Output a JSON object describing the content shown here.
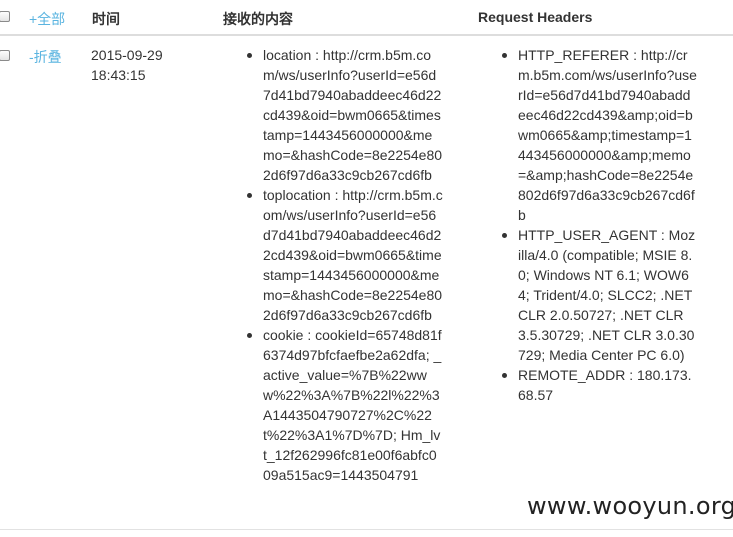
{
  "header": {
    "select_all_label": "+全部",
    "time_label": "时间",
    "content_label": "接收的内容",
    "headers_label": "Request Headers"
  },
  "row": {
    "fold_label": "-折叠",
    "time": "2015-09-29 18:43:15",
    "content_items": [
      "location : http://crm.b5m.com/ws/userInfo?userId=e56d7d41bd7940abaddeec46d22cd439&oid=bwm0665&timestamp=1443456000000&memo=&hashCode=8e2254e802d6f97d6a33c9cb267cd6fb",
      "toplocation : http://crm.b5m.com/ws/userInfo?userId=e56d7d41bd7940abaddeec46d22cd439&oid=bwm0665&timestamp=1443456000000&memo=&hashCode=8e2254e802d6f97d6a33c9cb267cd6fb",
      "cookie : cookieId=65748d81f6374d97bfcfaefbe2a62dfa; _active_value=%7B%22www%22%3A%7B%22l%22%3A1443504790727%2C%22t%22%3A1%7D%7D; Hm_lvt_12f262996fc81e00f6abfc009a515ac9=1443504791"
    ],
    "header_items": [
      "HTTP_REFERER : http://crm.b5m.com/ws/userInfo?userId=e56d7d41bd7940abaddeec46d22cd439&amp;oid=bwm0665&amp;timestamp=1443456000000&amp;memo=&amp;hashCode=8e2254e802d6f97d6a33c9cb267cd6fb",
      "HTTP_USER_AGENT : Mozilla/4.0 (compatible; MSIE 8.0; Windows NT 6.1; WOW64; Trident/4.0; SLCC2; .NET CLR 2.0.50727; .NET CLR 3.5.30729; .NET CLR 3.0.30729; Media Center PC 6.0)",
      "REMOTE_ADDR : 180.173.68.57"
    ]
  },
  "watermark": "www.wooyun.org"
}
